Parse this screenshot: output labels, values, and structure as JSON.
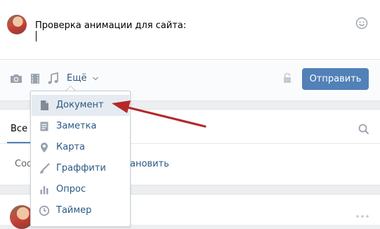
{
  "composer": {
    "text": "Проверка анимации для сайта:",
    "more_label": "Ещё",
    "send_label": "Отправить"
  },
  "menu": {
    "items": [
      {
        "label": "Документ",
        "icon": "document-icon"
      },
      {
        "label": "Заметка",
        "icon": "note-icon"
      },
      {
        "label": "Карта",
        "icon": "map-pin-icon"
      },
      {
        "label": "Граффити",
        "icon": "brush-icon"
      },
      {
        "label": "Опрос",
        "icon": "poll-icon"
      },
      {
        "label": "Таймер",
        "icon": "clock-icon"
      }
    ]
  },
  "feed": {
    "tab_active": "Все з",
    "notice_left": "Соо",
    "notice_right": "ановить"
  },
  "colors": {
    "accent": "#5181b8",
    "link": "#2a5885",
    "icon": "#99a2ad",
    "annotation": "#b5282a"
  }
}
